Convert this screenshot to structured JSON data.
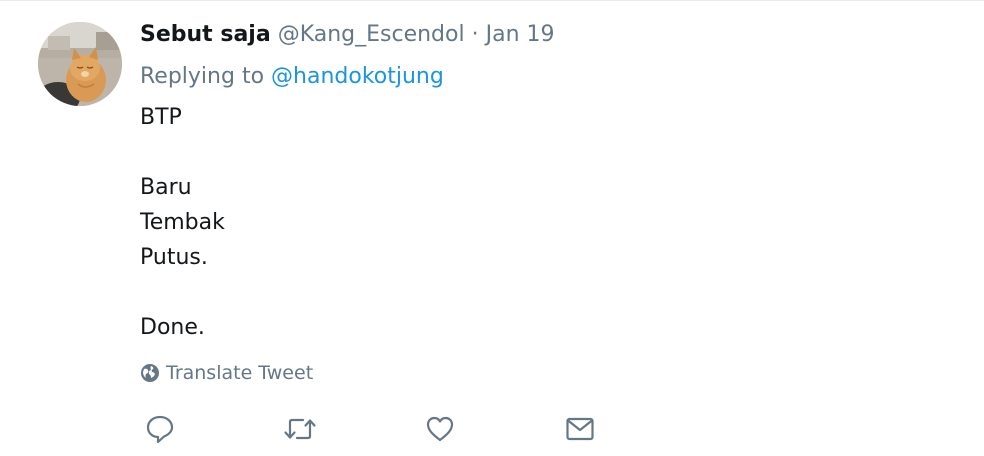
{
  "tweet": {
    "fullname": "Sebut saja",
    "username": "@Kang_Escendol",
    "separator": "·",
    "timestamp": "Jan 19",
    "replying_prefix": "Replying to",
    "replying_to": "@handokotjung",
    "text_lines": [
      "BTP",
      "",
      "Baru",
      "Tembak",
      "Putus.",
      "",
      "Done."
    ],
    "translate_label": "Translate Tweet"
  },
  "actions": {
    "reply_icon": "reply-icon",
    "retweet_icon": "retweet-icon",
    "like_icon": "heart-icon",
    "message_icon": "envelope-icon"
  },
  "colors": {
    "secondary_text": "#657786",
    "link": "#1b95e0",
    "primary_text": "#14171a"
  }
}
